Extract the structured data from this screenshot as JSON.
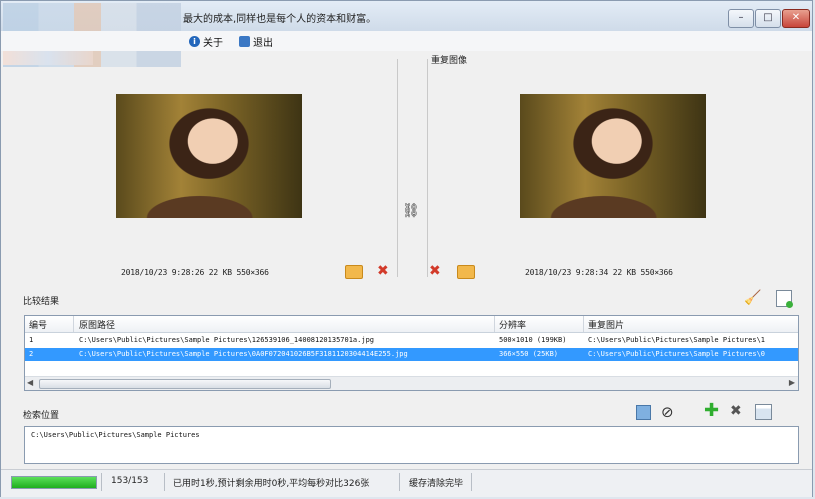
{
  "window": {
    "title": "最大的成本,同样也是每个人的资本和财富。",
    "controls": [
      "minimize",
      "maximize",
      "close"
    ]
  },
  "menu": {
    "about_label": "关于",
    "exit_label": "退出"
  },
  "left_image": {
    "date": "2018/10/23",
    "time": "9:28:26",
    "size": "22 KB",
    "resolution": "550×366"
  },
  "right_panel": {
    "title": "重复图像"
  },
  "right_image": {
    "date": "2018/10/23",
    "time": "9:28:34",
    "size": "22 KB",
    "resolution": "550×366"
  },
  "results": {
    "label": "比较结果",
    "columns": [
      "编号",
      "原图路径",
      "分辨率",
      "重复图片"
    ],
    "rows": [
      {
        "id": "1",
        "path": "C:\\Users\\Public\\Pictures\\Sample Pictures\\126539106_14008120135701a.jpg",
        "resolution": "500×1010 (199KB)",
        "duplicate": "C:\\Users\\Public\\Pictures\\Sample Pictures\\1",
        "selected": false
      },
      {
        "id": "2",
        "path": "C:\\Users\\Public\\Pictures\\Sample Pictures\\0A0F072041026B5F3181120304414E255.jpg",
        "resolution": "366×550 (25KB)",
        "duplicate": "C:\\Users\\Public\\Pictures\\Sample Pictures\\0",
        "selected": true
      }
    ]
  },
  "search": {
    "label": "检索位置",
    "path": "C:\\Users\\Public\\Pictures\\Sample Pictures"
  },
  "status": {
    "progress": 1.0,
    "count": "153/153",
    "elapsed": "已用时1秒,预计剩余用时0秒,平均每秒对比326张",
    "message": "缓存清除完毕"
  },
  "colors": {
    "selection": "#3399ff",
    "progress": "#1fae1f",
    "delete": "#d23a2a",
    "folder": "#f2b84b"
  }
}
